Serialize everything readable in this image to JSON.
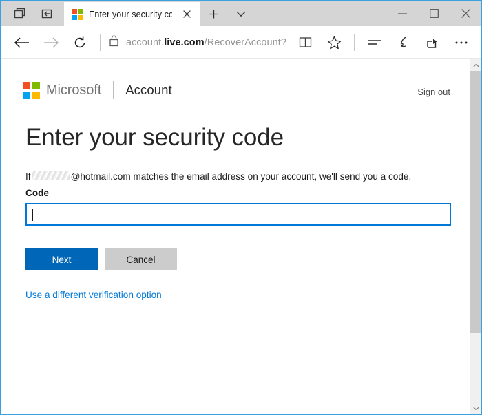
{
  "window": {
    "accent_color": "#0078d7",
    "titlebar_bg": "#d5d5d5"
  },
  "titlebar": {
    "left_icons": [
      {
        "name": "tabs-preview-icon",
        "label": "Tab preview"
      },
      {
        "name": "set-tabs-aside-icon",
        "label": "Set these tabs aside"
      }
    ],
    "tab": {
      "favicon": "microsoft-logo-icon",
      "title": "Enter your security code",
      "close_label": "✕"
    },
    "new_tab_label": "+",
    "tab_menu_label": "∨",
    "window_controls": {
      "minimize": "—",
      "maximize": "☐",
      "close": "✕"
    }
  },
  "toolbar": {
    "back_label": "Back",
    "forward_label": "Forward",
    "refresh_label": "Refresh",
    "lock_label": "Secure connection",
    "url": {
      "prefix": "account.",
      "domain": "live.com",
      "suffix": "/RecoverAccount?"
    },
    "right_icons": [
      {
        "name": "reading-view-icon",
        "label": "Reading view"
      },
      {
        "name": "favorites-star-icon",
        "label": "Add to favorites"
      },
      {
        "name": "hub-icon",
        "label": "Hub"
      },
      {
        "name": "web-note-icon",
        "label": "Make a Web Note"
      },
      {
        "name": "share-icon",
        "label": "Share"
      },
      {
        "name": "more-icon",
        "label": "Settings and more"
      }
    ]
  },
  "page": {
    "brand": {
      "logo_colors": [
        "#f25022",
        "#7fba00",
        "#00a4ef",
        "#ffb900"
      ],
      "name": "Microsoft",
      "product": "Account"
    },
    "sign_out_label": "Sign out",
    "title": "Enter your security code",
    "description": {
      "before": "If",
      "redacted": true,
      "after": "@hotmail.com matches the email address on your account, we'll send you a code."
    },
    "field": {
      "label": "Code",
      "value": "",
      "placeholder": "",
      "focused": true,
      "focus_color": "#0078d7"
    },
    "buttons": {
      "primary_label": "Next",
      "primary_color": "#0067b8",
      "secondary_label": "Cancel",
      "secondary_color": "#cccccc"
    },
    "alt_link_label": "Use a different verification option",
    "link_color": "#0078d7"
  },
  "scrollbar": {
    "up_arrow": "˄",
    "down_arrow": "˅",
    "thumb_position_percent": 0
  }
}
